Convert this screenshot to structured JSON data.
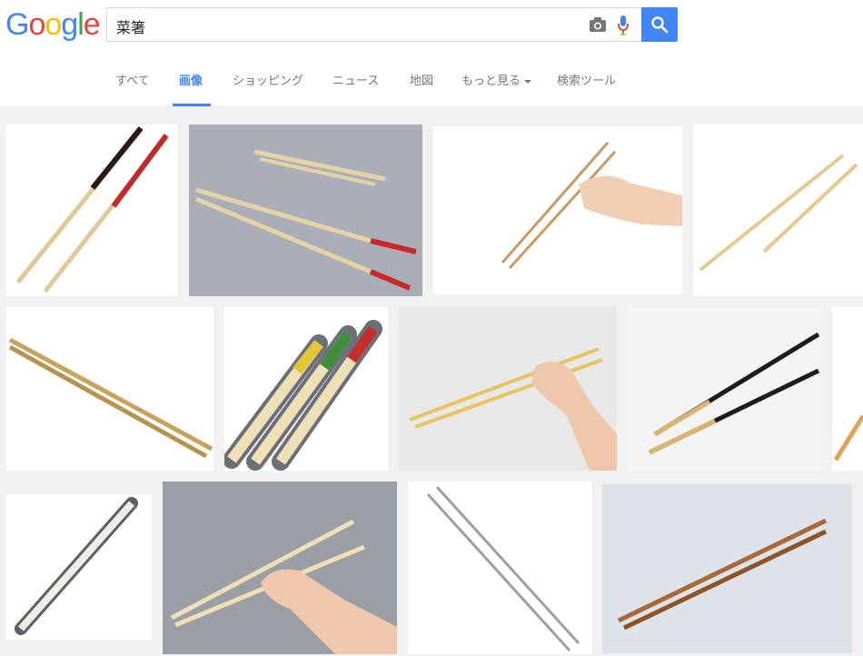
{
  "logo": {
    "letters": [
      "G",
      "o",
      "o",
      "g",
      "l",
      "e"
    ]
  },
  "search": {
    "query": "菜箸"
  },
  "tabs": [
    {
      "label": "すべて"
    },
    {
      "label": "画像"
    },
    {
      "label": "ショッピング"
    },
    {
      "label": "ニュース"
    },
    {
      "label": "地図"
    },
    {
      "label": "もっと見る"
    },
    {
      "label": "検索ツール"
    }
  ],
  "colors": {
    "accent": "#4285f4",
    "logo_blue": "#4285f4",
    "logo_red": "#ea4335",
    "logo_yellow": "#fbbc05",
    "logo_green": "#34a853"
  },
  "active_tab": "画像"
}
